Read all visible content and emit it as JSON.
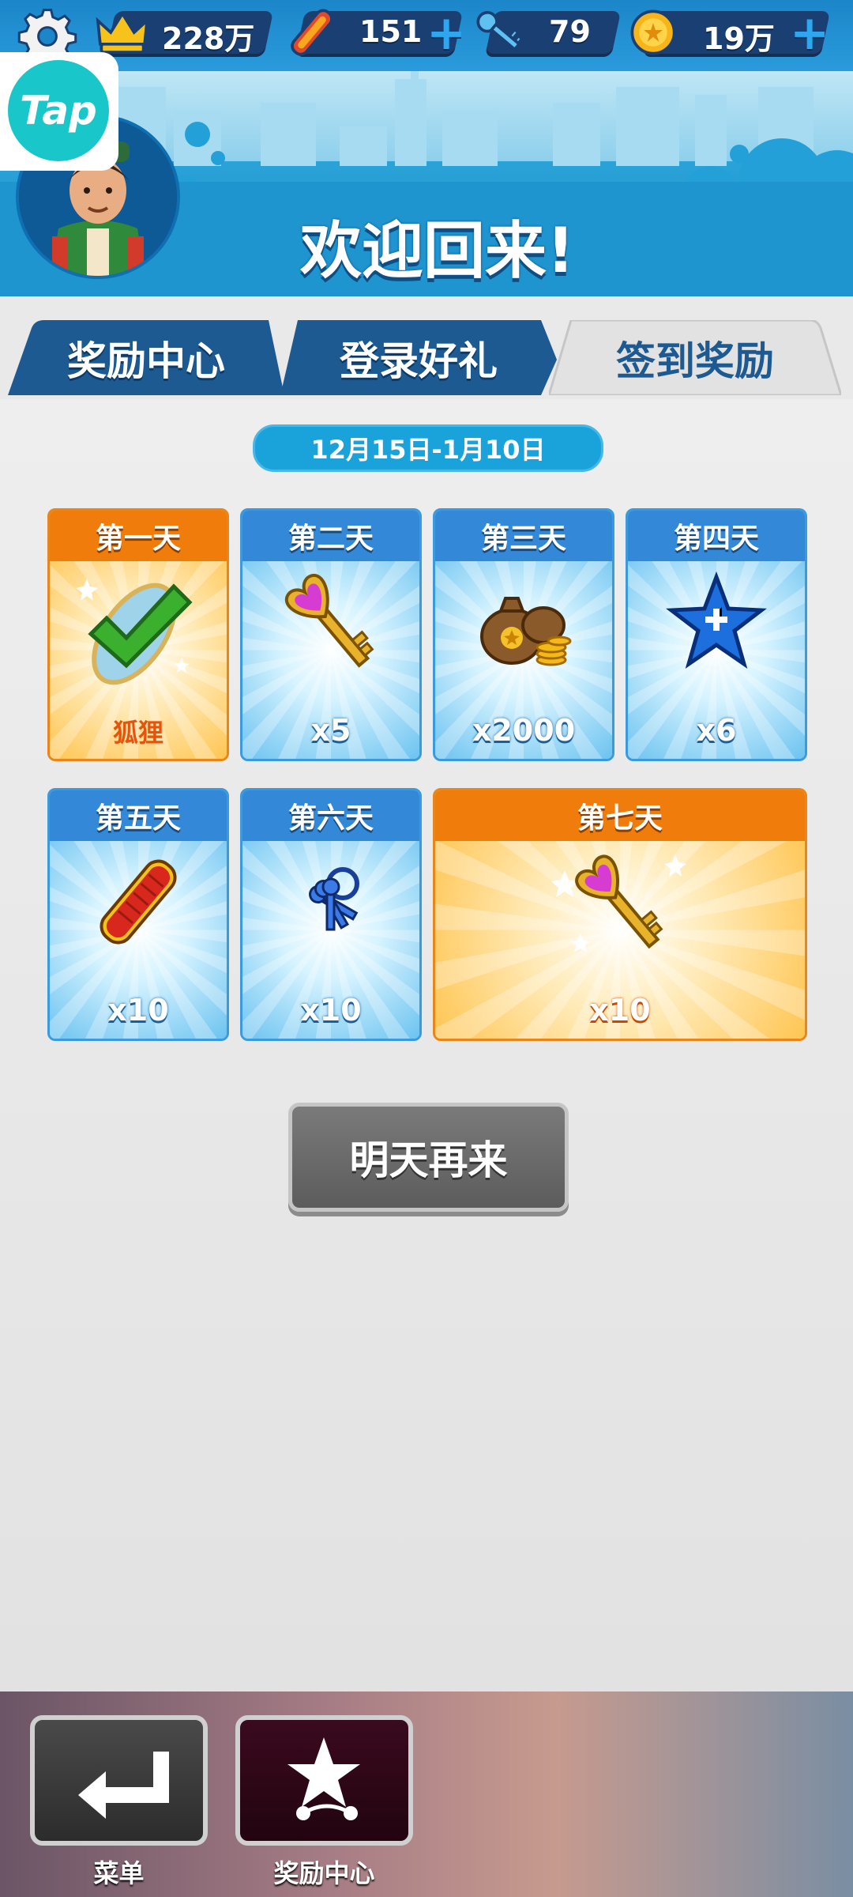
{
  "topbar": {
    "settings_icon": "gear-icon",
    "resources": [
      {
        "icon": "crown-icon",
        "value": "228万",
        "has_plus": false
      },
      {
        "icon": "hoverboard-icon",
        "value": "151",
        "has_plus": true
      },
      {
        "icon": "key-icon",
        "value": "79",
        "has_plus": false
      },
      {
        "icon": "coin-icon",
        "value": "19万",
        "has_plus": true
      }
    ],
    "plus": "+"
  },
  "tap": {
    "label": "Tap"
  },
  "header": {
    "welcome": "欢迎回来!"
  },
  "tabs": [
    {
      "label": "奖励中心",
      "active": false
    },
    {
      "label": "登录好礼",
      "active": false
    },
    {
      "label": "签到奖励",
      "active": true
    }
  ],
  "checkin": {
    "date_range": "12月15日-1月10日",
    "days": [
      {
        "title": "第一天",
        "reward": "狐狸",
        "icon": "claimed-check-icon",
        "state": "claimed"
      },
      {
        "title": "第二天",
        "reward": "x5",
        "icon": "heart-key-icon",
        "state": "locked"
      },
      {
        "title": "第三天",
        "reward": "x2000",
        "icon": "coin-bag-icon",
        "state": "locked"
      },
      {
        "title": "第四天",
        "reward": "x6",
        "icon": "star-icon",
        "state": "locked"
      },
      {
        "title": "第五天",
        "reward": "x10",
        "icon": "hoverboard-icon",
        "state": "locked"
      },
      {
        "title": "第六天",
        "reward": "x10",
        "icon": "keys-bundle-icon",
        "state": "locked"
      },
      {
        "title": "第七天",
        "reward": "x10",
        "icon": "heart-key-icon",
        "state": "locked"
      }
    ],
    "button": "明天再来"
  },
  "bottom_nav": [
    {
      "label": "菜单",
      "icon": "return-arrow-icon"
    },
    {
      "label": "奖励中心",
      "icon": "reward-star-icon"
    }
  ],
  "colors": {
    "primary_blue": "#1b86c9",
    "tab_blue": "#1e5a92",
    "gold": "#f07d0b",
    "button_gray": "#666666"
  }
}
